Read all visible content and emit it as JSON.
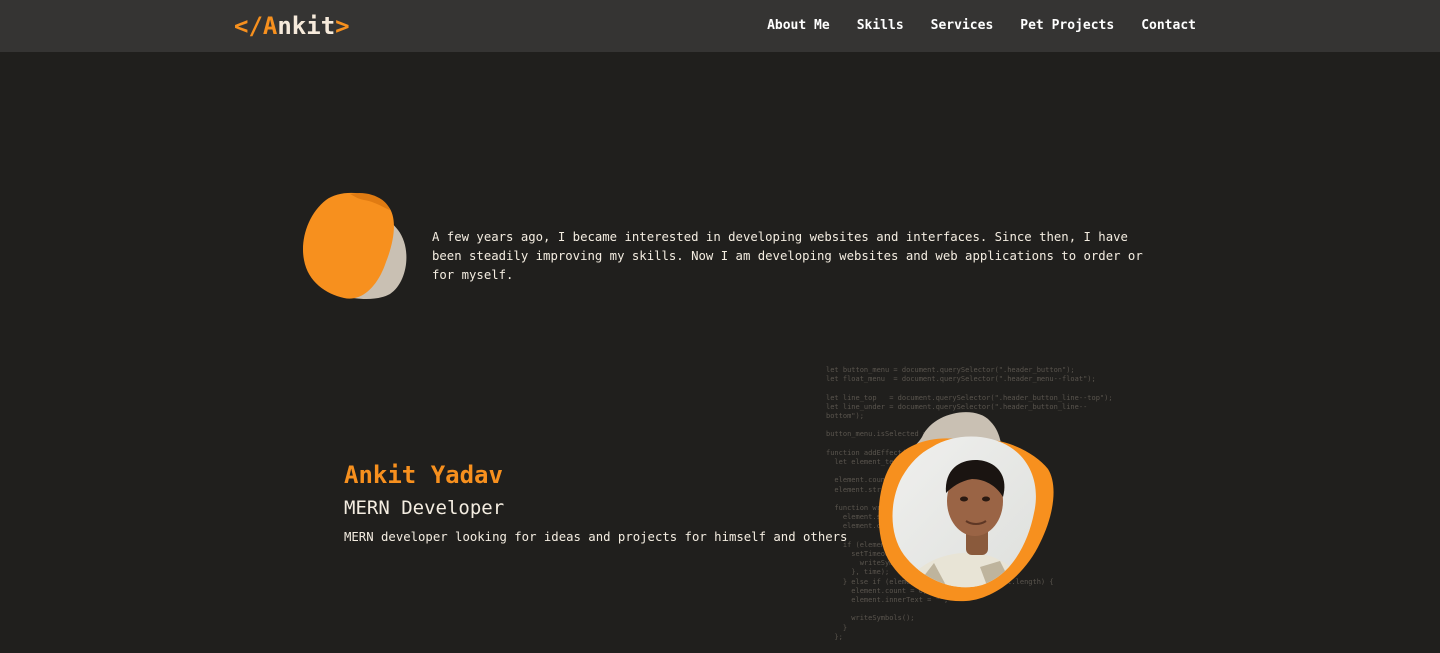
{
  "header": {
    "logo": {
      "open_bracket": "</",
      "initial": "A",
      "rest": "nkit",
      "close_bracket": ">"
    },
    "nav": [
      {
        "label": "About Me"
      },
      {
        "label": "Skills"
      },
      {
        "label": "Services"
      },
      {
        "label": "Pet Projects"
      },
      {
        "label": "Contact"
      }
    ]
  },
  "about": {
    "text": "A few years ago, I became interested in developing websites and interfaces. Since then, I have been steadily improving my skills. Now I am developing websites and web applications to order or for myself."
  },
  "hero": {
    "name": "Ankit Yadav",
    "role": "MERN Developer",
    "description": "MERN developer looking for ideas and projects for himself and others"
  },
  "code_background": "let button_menu = document.querySelector(\".header_button\");\nlet float_menu  = document.querySelector(\".header_menu--float\");\n\nlet line_top   = document.querySelector(\".header_button_line--top\");\nlet line_under = document.querySelector(\".header_button_line--\nbottom\");\n\nbutton_menu.isSelected = false;\n\nfunction addEffect(element) {\n  let element_text = element.innerText;\n\n  element.count = 0;\n  element.str = \"\";\n\n  function writeSymbols() {\n    element.str += element_text[element.count];\n    element.count++;\n\n    if (element.count < element_text.length) {\n      setTimeout(() => {\n        writeSymbols();\n      }, time);\n    } else if (element.count == element_text.length) {\n      element.count = 0;\n      element.innerText = \"\";\n\n      writeSymbols();\n    }\n  };",
  "colors": {
    "accent": "#f7901e",
    "background": "#201f1d",
    "header_bg": "#353433",
    "blob_beige": "#c9c0b3",
    "text": "#f4ede1"
  }
}
